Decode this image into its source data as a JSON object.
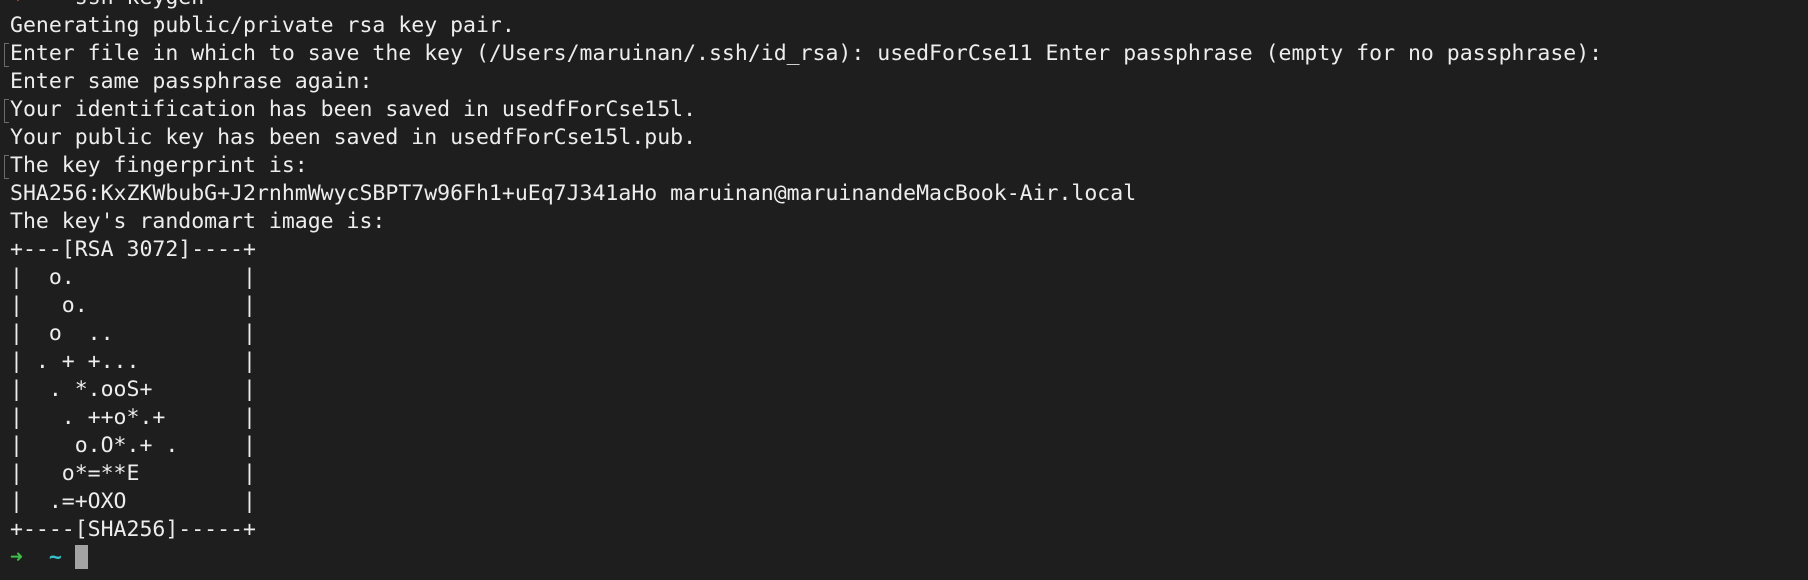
{
  "terminal": {
    "partial_top_line": "",
    "prompt_arrow": "➜",
    "prompt_dir": "~",
    "command": "ssh-keygen",
    "lines": [
      "Generating public/private rsa key pair.",
      "Enter file in which to save the key (/Users/maruinan/.ssh/id_rsa): usedForCse11 Enter passphrase (empty for no passphrase):",
      "Enter same passphrase again:",
      "Your identification has been saved in usedfForCse15l.",
      "Your public key has been saved in usedfForCse15l.pub.",
      "The key fingerprint is:",
      "SHA256:KxZKWbubG+J2rnhmWwycSBPT7w96Fh1+uEq7J341aHo maruinan@maruinandeMacBook-Air.local",
      "The key's randomart image is:"
    ],
    "randomart": [
      "+---[RSA 3072]----+",
      "|  o.             |",
      "|   o.            |",
      "|  o  ..          |",
      "| . + +...        |",
      "|  . *.ooS+       |",
      "|   . ++o*.+      |",
      "|    o.O*.+ .     |",
      "|   o*=**E        |",
      "|  .=+OXO         |",
      "+----[SHA256]-----+"
    ],
    "final_prompt_arrow": "➜",
    "final_prompt_dir": "~"
  }
}
